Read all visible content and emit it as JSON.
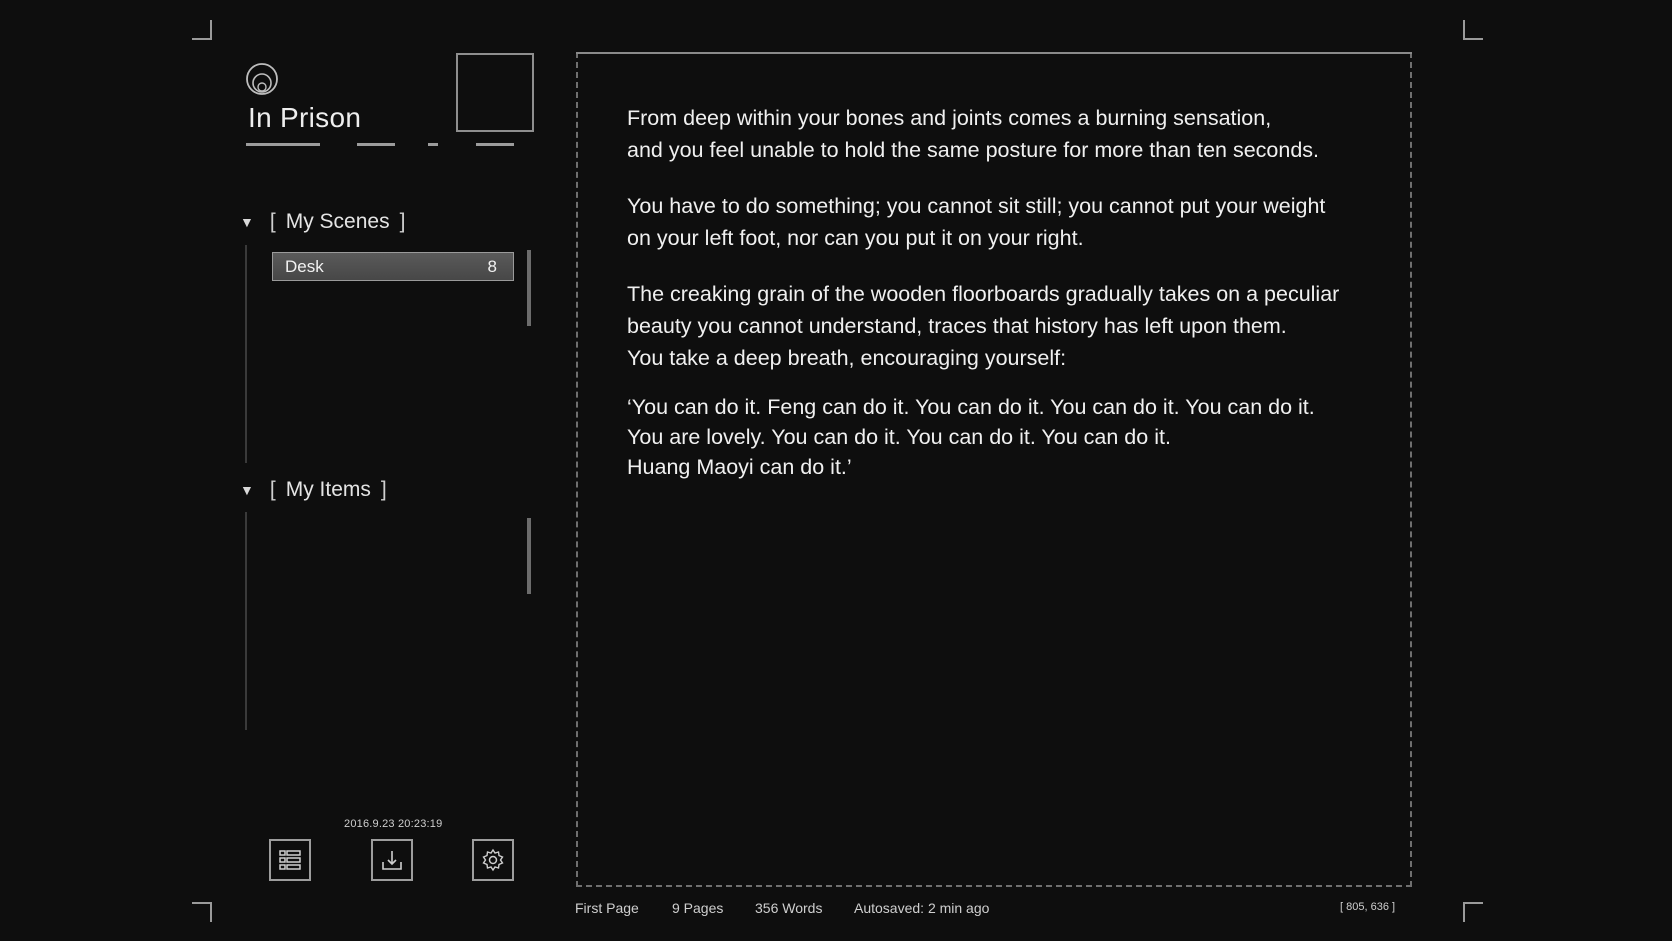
{
  "project": {
    "title": "In Prison"
  },
  "sidebar": {
    "scenes": {
      "header": "My Scenes",
      "items": [
        {
          "label": "Desk",
          "count": "8"
        }
      ]
    },
    "items": {
      "header": "My Items"
    },
    "timestamp": "2016.9.23  20:23:19",
    "buttons": {
      "list": "list-icon",
      "export": "download-icon",
      "settings": "gear-icon"
    }
  },
  "story": {
    "paragraphs": [
      "From deep within your bones and joints comes a burning sensation,\nand you feel unable to hold the same posture for more than ten seconds.",
      "You have to do something; you cannot sit still; you cannot put your weight\non your left foot, nor can you put it on your right.",
      "The creaking grain of the wooden floorboards gradually takes on a peculiar\nbeauty you cannot understand, traces that history has left upon them.\nYou take a deep breath, encouraging yourself:",
      "‘You can do it. Feng can do it. You can do it. You can do it. You can do it.\nYou are lovely. You can do it. You can do it. You can do it.\nHuang Maoyi can do it.’"
    ]
  },
  "status_bar": {
    "page": "First Page",
    "pages": "9 Pages",
    "words": "356 Words",
    "autosave": "Autosaved: 2 min ago",
    "coords": "[ 805,  636 ]"
  },
  "colors": {
    "background": "#0e0e0e",
    "border": "#8e8e8e",
    "selected_item": "#4f4f4f",
    "text": "#f0f0f0"
  }
}
